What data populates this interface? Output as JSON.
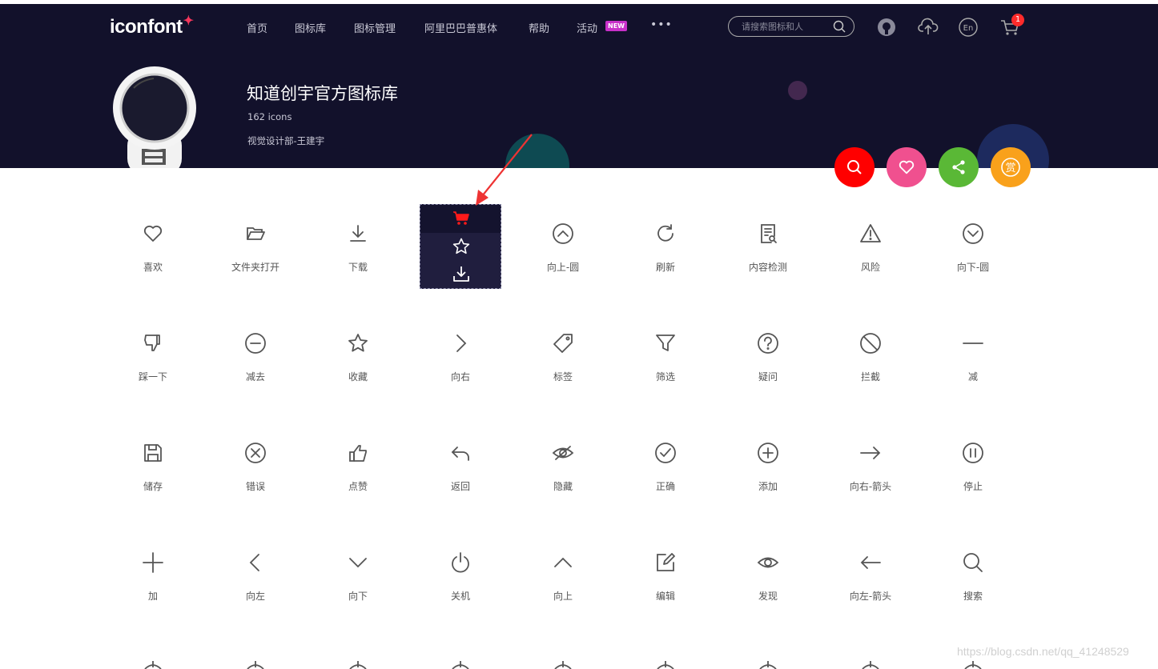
{
  "header": {
    "logo": "iconfont",
    "nav": [
      "首页",
      "图标库",
      "图标管理",
      "阿里巴巴普惠体",
      "帮助",
      "活动"
    ],
    "new_badge": "NEW",
    "more": "•••",
    "search_placeholder": "请搜索图标和人",
    "cart_count": "1",
    "lang": "En"
  },
  "library": {
    "title": "知道创宇官方图标库",
    "count": "162 icons",
    "author": "视觉设计部-王建宇"
  },
  "actions": {
    "search_color": "#ff0000",
    "favorite_color": "#f0508f",
    "share_color": "#5ab836",
    "reward_color": "#f9a11b",
    "reward_label": "赏"
  },
  "hover_card": {
    "cart_color": "#ff1a1a",
    "icons": [
      "cart-icon",
      "star-icon",
      "download-icon"
    ]
  },
  "icons": [
    {
      "label": "喜欢",
      "icon": "heart"
    },
    {
      "label": "文件夹打开",
      "icon": "folder-open"
    },
    {
      "label": "下载",
      "icon": "download"
    },
    {
      "label": "",
      "icon": "hover"
    },
    {
      "label": "向上-圆",
      "icon": "up-circle"
    },
    {
      "label": "刷新",
      "icon": "refresh"
    },
    {
      "label": "内容检测",
      "icon": "doc-search"
    },
    {
      "label": "风险",
      "icon": "warning"
    },
    {
      "label": "向下-圆",
      "icon": "down-circle"
    },
    {
      "label": "踩一下",
      "icon": "thumb-down"
    },
    {
      "label": "减去",
      "icon": "minus-circle"
    },
    {
      "label": "收藏",
      "icon": "star"
    },
    {
      "label": "向右",
      "icon": "chevron-right"
    },
    {
      "label": "标签",
      "icon": "tag"
    },
    {
      "label": "筛选",
      "icon": "filter"
    },
    {
      "label": "疑问",
      "icon": "question"
    },
    {
      "label": "拦截",
      "icon": "block"
    },
    {
      "label": "减",
      "icon": "minus"
    },
    {
      "label": "储存",
      "icon": "save"
    },
    {
      "label": "错误",
      "icon": "x-circle"
    },
    {
      "label": "点赞",
      "icon": "thumb-up"
    },
    {
      "label": "返回",
      "icon": "back"
    },
    {
      "label": "隐藏",
      "icon": "eye-off"
    },
    {
      "label": "正确",
      "icon": "check-circle"
    },
    {
      "label": "添加",
      "icon": "plus-circle"
    },
    {
      "label": "向右-箭头",
      "icon": "arrow-right"
    },
    {
      "label": "停止",
      "icon": "pause-circle"
    },
    {
      "label": "加",
      "icon": "plus"
    },
    {
      "label": "向左",
      "icon": "chevron-left"
    },
    {
      "label": "向下",
      "icon": "chevron-down"
    },
    {
      "label": "关机",
      "icon": "power"
    },
    {
      "label": "向上",
      "icon": "chevron-up"
    },
    {
      "label": "编辑",
      "icon": "edit"
    },
    {
      "label": "发现",
      "icon": "eye"
    },
    {
      "label": "向左-箭头",
      "icon": "arrow-left"
    },
    {
      "label": "搜索",
      "icon": "search"
    }
  ],
  "watermark": "https://blog.csdn.net/qq_41248529"
}
